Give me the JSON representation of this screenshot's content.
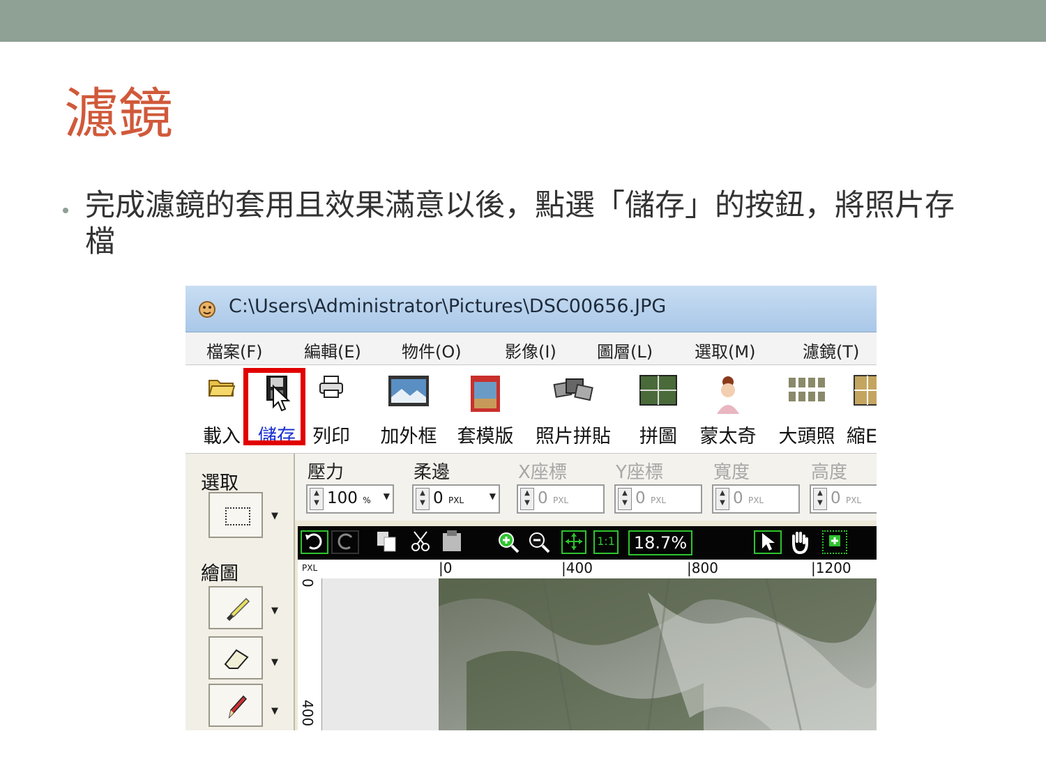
{
  "slide": {
    "title": "濾鏡",
    "bullet": "完成濾鏡的套用且效果滿意以後，點選「儲存」的按鈕，將照片存檔"
  },
  "window": {
    "title": "C:\\Users\\Administrator\\Pictures\\DSC00656.JPG",
    "menu": [
      "檔案(F)",
      "編輯(E)",
      "物件(O)",
      "影像(I)",
      "圖層(L)",
      "選取(M)",
      "濾鏡(T)"
    ],
    "toolbar": [
      {
        "label": "載入",
        "icon": "folder-open-icon"
      },
      {
        "label": "儲存",
        "icon": "save-disk-icon",
        "active": true
      },
      {
        "label": "列印",
        "icon": "printer-icon"
      },
      {
        "label": "加外框",
        "icon": "frame-icon"
      },
      {
        "label": "套模版",
        "icon": "template-icon"
      },
      {
        "label": "照片拼貼",
        "icon": "collage-icon"
      },
      {
        "label": "拼圖",
        "icon": "puzzle-icon"
      },
      {
        "label": "蒙太奇",
        "icon": "montage-icon"
      },
      {
        "label": "大頭照",
        "icon": "id-photo-icon"
      },
      {
        "label": "縮E",
        "icon": "thumbnail-icon"
      }
    ],
    "left_panel": {
      "select_label": "選取",
      "draw_label": "繪圖"
    },
    "params": [
      {
        "label": "壓力",
        "value": "100",
        "unit": "%",
        "disabled": false
      },
      {
        "label": "柔邊",
        "value": "0",
        "unit": "PXL",
        "disabled": false
      },
      {
        "label": "X座標",
        "value": "0",
        "unit": "PXL",
        "disabled": true
      },
      {
        "label": "Y座標",
        "value": "0",
        "unit": "PXL",
        "disabled": true
      },
      {
        "label": "寬度",
        "value": "0",
        "unit": "PXL",
        "disabled": true
      },
      {
        "label": "高度",
        "value": "0",
        "unit": "PXL",
        "disabled": true
      }
    ],
    "zoom": "18.7%",
    "ruler": {
      "unit": "PXL",
      "top_ticks": [
        "0",
        "400",
        "800",
        "1200"
      ],
      "left_ticks": [
        "0",
        "400"
      ]
    }
  },
  "colors": {
    "accent_title": "#d0593a",
    "top_band": "#8fa095",
    "highlight": "#e10000",
    "active_label": "#1a2fd1"
  }
}
